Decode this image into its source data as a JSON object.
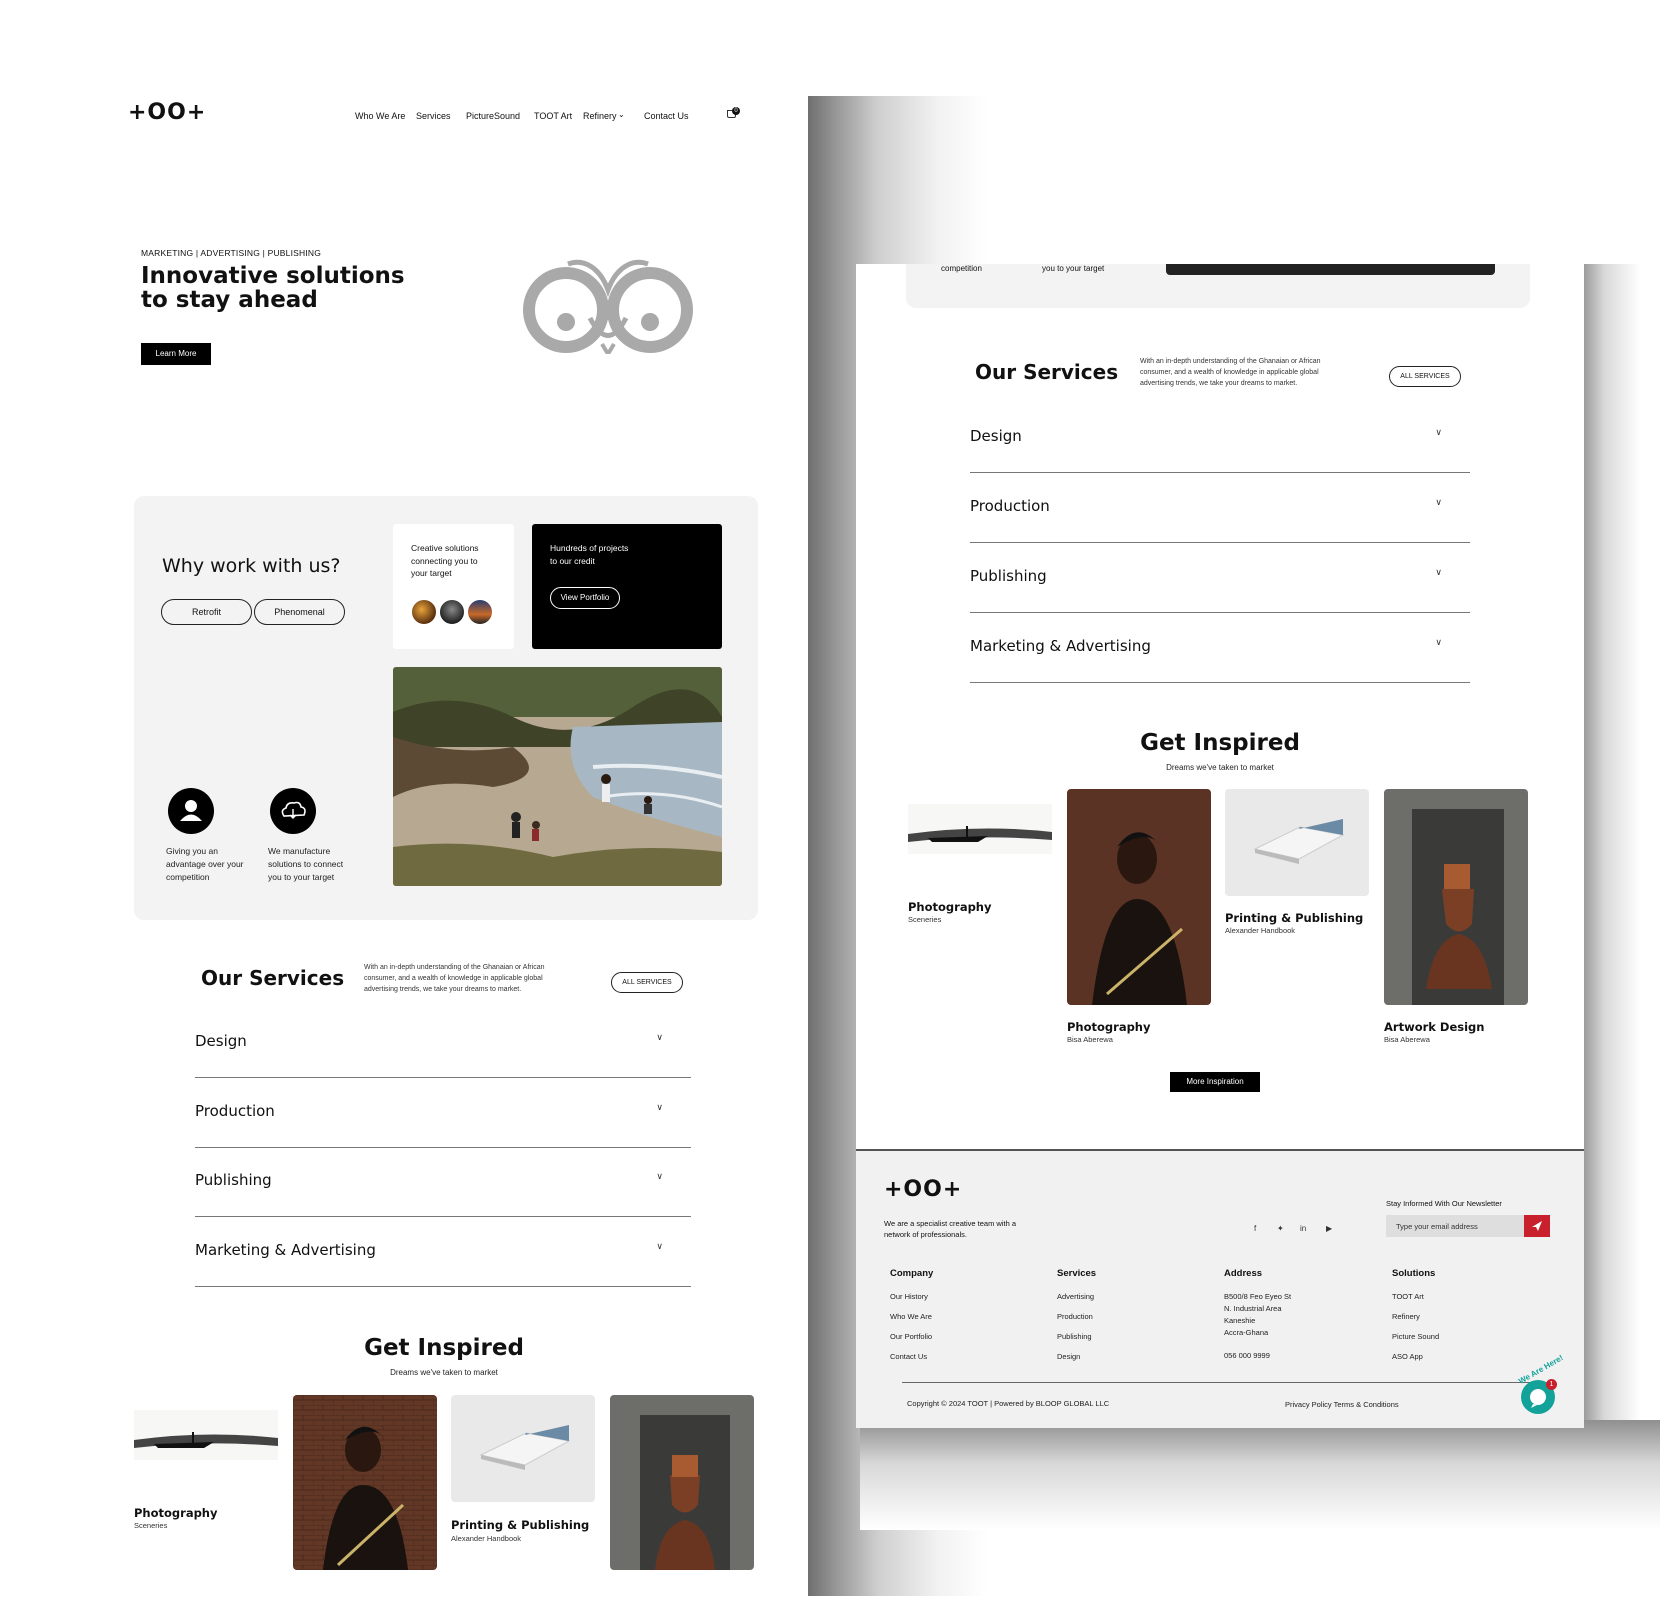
{
  "brand": {
    "logo": "+OO+"
  },
  "nav": {
    "items": [
      "Who We Are",
      "Services",
      "PictureSound",
      "TOOT Art",
      "Refinery",
      "Contact Us"
    ],
    "cart_count": "0"
  },
  "hero": {
    "eyebrow": "MARKETING | ADVERTISING | PUBLISHING",
    "title_line1": "Innovative solutions",
    "title_line2": "to stay ahead",
    "cta": "Learn More"
  },
  "why": {
    "title": "Why work with us?",
    "pills": [
      "Retrofit",
      "Phenomenal"
    ],
    "card1_text": [
      "Creative solutions",
      "connecting you to",
      "your target"
    ],
    "card2_text": [
      "Hundreds of projects",
      "to our credit"
    ],
    "card2_button": "View Portfolio",
    "feature1": [
      "Giving you an",
      "advantage over your",
      "competition"
    ],
    "feature2": [
      "We manufacture",
      "solutions to connect",
      "you to your target"
    ],
    "icons": {
      "feature1": "user-icon",
      "feature2": "cloud-icon"
    }
  },
  "services": {
    "title": "Our Services",
    "description": [
      "With an in-depth understanding of the Ghanaian or African",
      "consumer, and a wealth of knowledge in applicable global",
      "advertising trends, we take your dreams to market."
    ],
    "button": "ALL SERVICES",
    "items": [
      "Design",
      "Production",
      "Publishing",
      "Marketing & Advertising"
    ]
  },
  "inspired": {
    "title": "Get Inspired",
    "subtitle": "Dreams we've taken to market",
    "tiles": [
      {
        "title": "Photography",
        "sub": "Sceneries"
      },
      {
        "title": "Photography",
        "sub": "Bisa Aberewa"
      },
      {
        "title": "Printing & Publishing",
        "sub": "Alexander Handbook"
      },
      {
        "title": "Artwork Design",
        "sub": "Bisa Aberewa"
      }
    ],
    "more_button": "More Inspiration"
  },
  "right_top_snippet": {
    "left": "competition",
    "right": "you to your target"
  },
  "footer": {
    "tagline": [
      "We are a specialist creative team with a",
      "network of professionals."
    ],
    "newsletter_label": "Stay Informed With Our Newsletter",
    "newsletter_placeholder": "Type your email address",
    "social_icons": [
      "facebook-icon",
      "twitter-icon",
      "linkedin-icon",
      "youtube-icon"
    ],
    "columns": {
      "company": {
        "title": "Company",
        "links": [
          "Our History",
          "Who We Are",
          "Our Portfolio",
          "Contact Us"
        ]
      },
      "services": {
        "title": "Services",
        "links": [
          "Advertising",
          "Production",
          "Publishing",
          "Design"
        ]
      },
      "address": {
        "title": "Address",
        "lines": [
          "B500/8 Feo Eyeo St",
          "N. Industrial Area",
          "Kaneshie",
          "Accra-Ghana"
        ],
        "phone": "056 000 9999"
      },
      "solutions": {
        "title": "Solutions",
        "links": [
          "TOOT Art",
          "Refinery",
          "Picture Sound",
          "ASO App"
        ]
      }
    },
    "copyright": "Copyright © 2024 TOOT | Powered by BLOOP GLOBAL LLC",
    "legal": "Privacy Policy  Terms & Conditions",
    "chat_badge": "We Are Here!",
    "chat_count": "1"
  },
  "colors": {
    "accent_red": "#c8202c",
    "dark": "#000000",
    "panel": "#f3f3f3"
  }
}
